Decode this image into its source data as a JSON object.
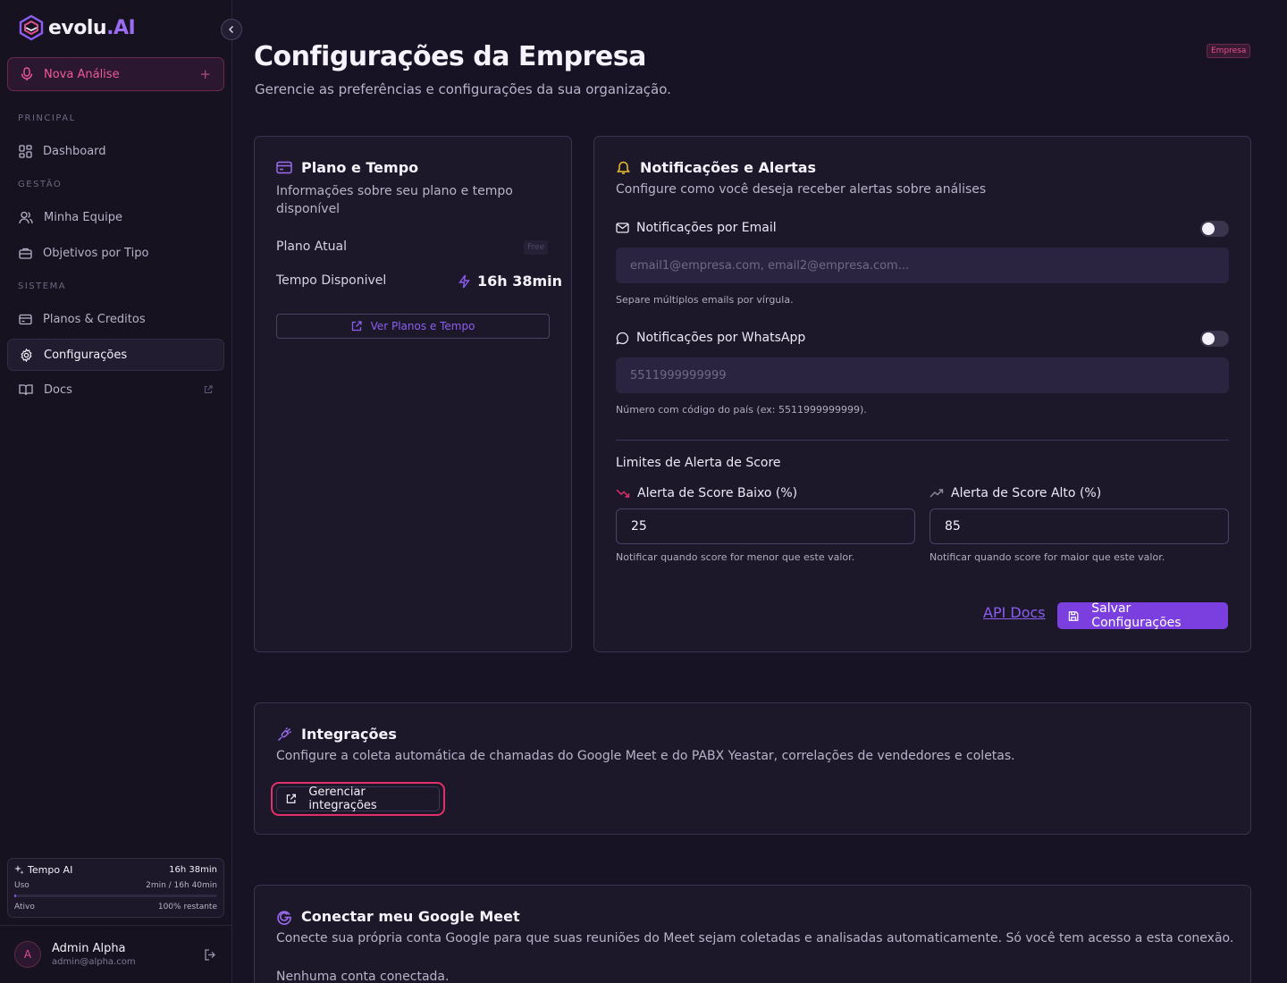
{
  "brand": {
    "name": "evolu",
    "suffix": ".AI"
  },
  "sidebar": {
    "new_analysis": "Nova Análise",
    "plus": "+",
    "sections": {
      "principal": "PRINCIPAL",
      "gestao": "GESTÃO",
      "sistema": "SISTEMA"
    },
    "items": {
      "dashboard": "Dashboard",
      "team": "Minha Equipe",
      "objectives": "Objetivos por Tipo",
      "plans": "Planos & Creditos",
      "settings": "Configurações",
      "docs": "Docs"
    },
    "tempo": {
      "title": "Tempo AI",
      "total": "16h 38min",
      "usage_label": "Uso",
      "usage_value": "2min / 16h 40min",
      "usage_fraction": 0.002,
      "status": "Ativo",
      "remaining": "100% restante"
    },
    "user": {
      "initial": "A",
      "name": "Admin Alpha",
      "email": "admin@alpha.com"
    }
  },
  "header": {
    "title": "Configurações da Empresa",
    "subtitle": "Gerencie as preferências e configurações da sua organização.",
    "badge": "Empresa"
  },
  "plan_card": {
    "title": "Plano e Tempo",
    "description": "Informações sobre seu plano e tempo disponível",
    "current_plan_label": "Plano Atual",
    "current_plan_value": "Free",
    "time_label": "Tempo Disponivel",
    "time_value": "16h 38min",
    "button": "Ver Planos e Tempo"
  },
  "notifications": {
    "title": "Notificações e Alertas",
    "description": "Configure como você deseja receber alertas sobre análises",
    "email_label": "Notificações por Email",
    "email_enabled": false,
    "email_placeholder": "email1@empresa.com, email2@empresa.com...",
    "email_hint": "Separe múltiplos emails por vírgula.",
    "whatsapp_label": "Notificações por WhatsApp",
    "whatsapp_enabled": false,
    "whatsapp_placeholder": "5511999999999",
    "whatsapp_hint": "Número com código do país (ex: 5511999999999).",
    "limits_title": "Limites de Alerta de Score",
    "low_label": "Alerta de Score Baixo (%)",
    "low_value": "25",
    "low_hint": "Notificar quando score for menor que este valor.",
    "high_label": "Alerta de Score Alto (%)",
    "high_value": "85",
    "high_hint": "Notificar quando score for maior que este valor.",
    "api_docs": "API Docs",
    "save": "Salvar Configurações"
  },
  "integrations": {
    "title": "Integrações",
    "description": "Configure a coleta automática de chamadas do Google Meet e do PABX Yeastar, correlações de vendedores e coletas.",
    "button": "Gerenciar integrações"
  },
  "google_meet": {
    "title": "Conectar meu Google Meet",
    "description": "Conecte sua própria conta Google para que suas reuniões do Meet sejam coletadas e analisadas automaticamente. Só você tem acesso a esta conexão.",
    "status": "Nenhuma conta conectada."
  },
  "colors": {
    "accent": "#7b3fe0",
    "pink": "#e0306a",
    "background": "#171325",
    "card": "#1d1829"
  }
}
